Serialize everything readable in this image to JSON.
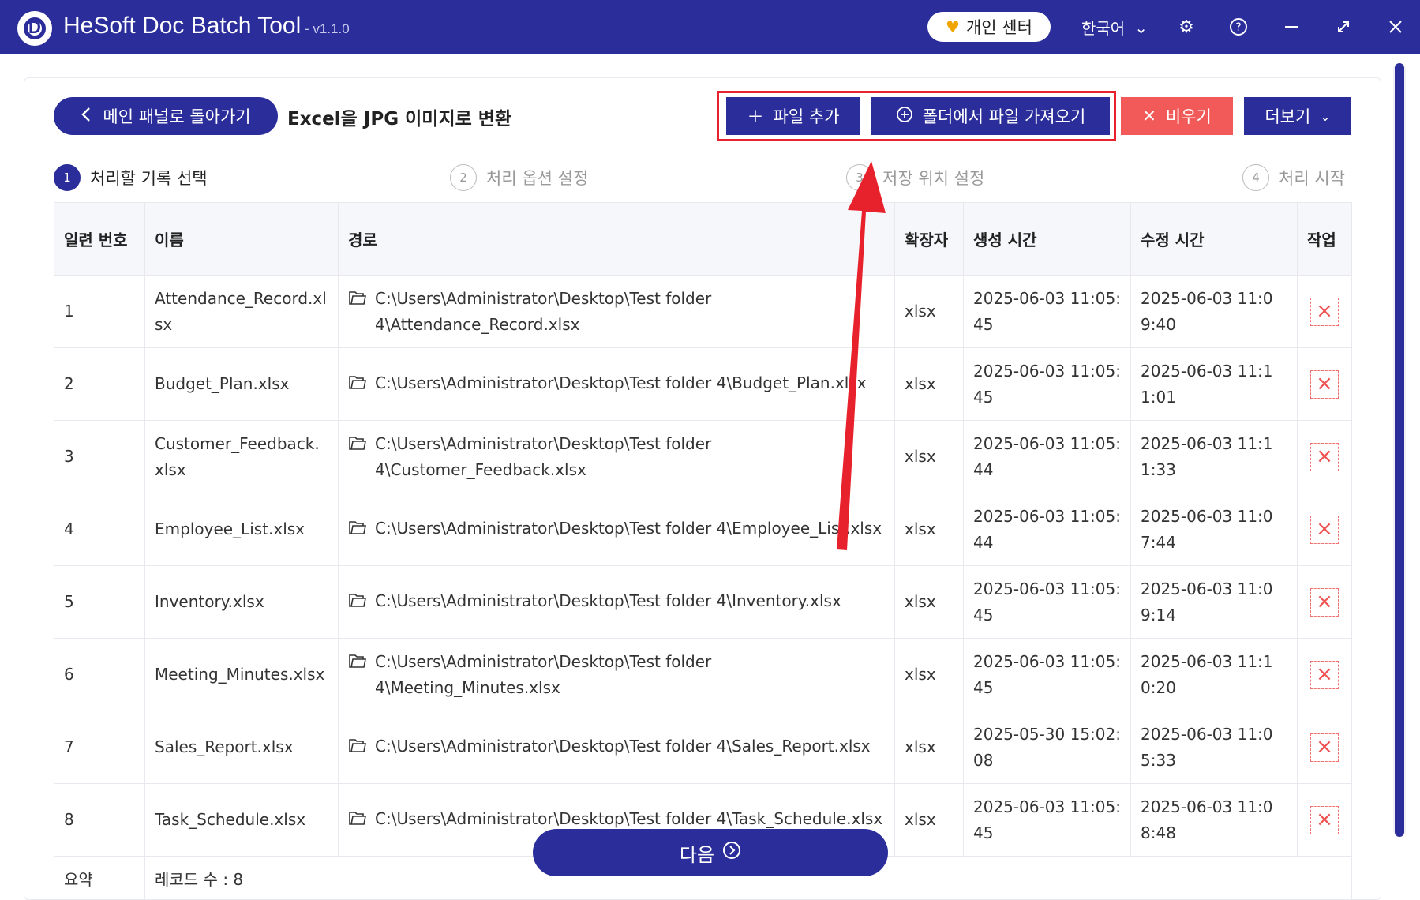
{
  "titlebar": {
    "app_title": "HeSoft Doc Batch Tool",
    "version": "- v1.1.0",
    "logo_letter": "D",
    "personal_center": "개인 센터",
    "language": "한국어",
    "icons": [
      "gear-icon",
      "help-icon",
      "minimize-icon",
      "maximize-icon",
      "close-icon"
    ]
  },
  "header": {
    "back_label": "메인 패널로 돌아가기",
    "title": "Excel을 JPG 이미지로 변환",
    "add_file": "파일 추가",
    "import_folder": "폴더에서 파일 가져오기",
    "clear": "비우기",
    "more": "더보기"
  },
  "steps": [
    {
      "num": "1",
      "label": "처리할 기록 선택"
    },
    {
      "num": "2",
      "label": "처리 옵션 설정"
    },
    {
      "num": "3",
      "label": "저장 위치 설정"
    },
    {
      "num": "4",
      "label": "처리 시작"
    }
  ],
  "table": {
    "headers": [
      "일련 번호",
      "이름",
      "경로",
      "확장자",
      "생성 시간",
      "수정 시간",
      "작업"
    ],
    "rows": [
      {
        "no": "1",
        "name": "Attendance_Record.xlsx",
        "path": "C:\\Users\\Administrator\\Desktop\\Test folder 4\\Attendance_Record.xlsx",
        "ext": "xlsx",
        "created": "2025-06-03 11:05:45",
        "modified": "2025-06-03 11:09:40"
      },
      {
        "no": "2",
        "name": "Budget_Plan.xlsx",
        "path": "C:\\Users\\Administrator\\Desktop\\Test folder 4\\Budget_Plan.xlsx",
        "ext": "xlsx",
        "created": "2025-06-03 11:05:45",
        "modified": "2025-06-03 11:11:01"
      },
      {
        "no": "3",
        "name": "Customer_Feedback.xlsx",
        "path": "C:\\Users\\Administrator\\Desktop\\Test folder 4\\Customer_Feedback.xlsx",
        "ext": "xlsx",
        "created": "2025-06-03 11:05:44",
        "modified": "2025-06-03 11:11:33"
      },
      {
        "no": "4",
        "name": "Employee_List.xlsx",
        "path": "C:\\Users\\Administrator\\Desktop\\Test folder 4\\Employee_List.xlsx",
        "ext": "xlsx",
        "created": "2025-06-03 11:05:44",
        "modified": "2025-06-03 11:07:44"
      },
      {
        "no": "5",
        "name": "Inventory.xlsx",
        "path": "C:\\Users\\Administrator\\Desktop\\Test folder 4\\Inventory.xlsx",
        "ext": "xlsx",
        "created": "2025-06-03 11:05:45",
        "modified": "2025-06-03 11:09:14"
      },
      {
        "no": "6",
        "name": "Meeting_Minutes.xlsx",
        "path": "C:\\Users\\Administrator\\Desktop\\Test folder 4\\Meeting_Minutes.xlsx",
        "ext": "xlsx",
        "created": "2025-06-03 11:05:45",
        "modified": "2025-06-03 11:10:20"
      },
      {
        "no": "7",
        "name": "Sales_Report.xlsx",
        "path": "C:\\Users\\Administrator\\Desktop\\Test folder 4\\Sales_Report.xlsx",
        "ext": "xlsx",
        "created": "2025-05-30 15:02:08",
        "modified": "2025-06-03 11:05:33"
      },
      {
        "no": "8",
        "name": "Task_Schedule.xlsx",
        "path": "C:\\Users\\Administrator\\Desktop\\Test folder 4\\Task_Schedule.xlsx",
        "ext": "xlsx",
        "created": "2025-06-03 11:05:45",
        "modified": "2025-06-03 11:08:48"
      }
    ],
    "summary_label": "요약",
    "summary_value": "레코드 수 : 8"
  },
  "footer": {
    "next_label": "다음"
  },
  "colors": {
    "primary": "#2a2d9a",
    "danger": "#f25a5a",
    "highlight": "#e8222c"
  }
}
